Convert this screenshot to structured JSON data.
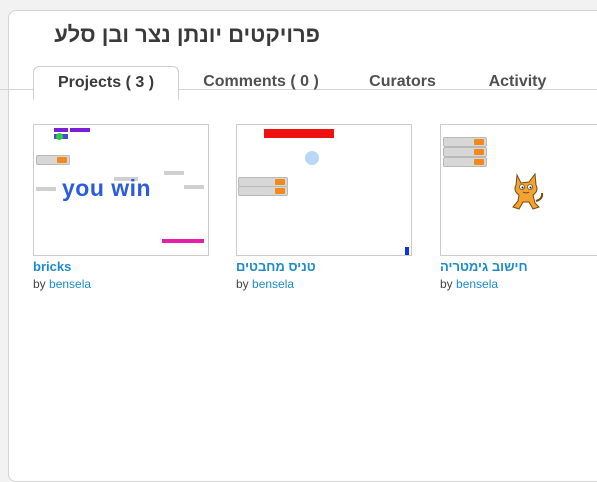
{
  "gallery": {
    "title": "פרויקטים יונתן נצר ובן סלע"
  },
  "tabs": [
    {
      "label": "Projects ( 3 )",
      "active": true
    },
    {
      "label": "Comments ( 0 )",
      "active": false
    },
    {
      "label": "Curators",
      "active": false
    },
    {
      "label": "Activity",
      "active": false
    }
  ],
  "projects": [
    {
      "title": "bricks",
      "by_prefix": "by",
      "author": "bensela",
      "thumb_text": "you win"
    },
    {
      "title": "טניס מחבטים",
      "by_prefix": "by",
      "author": "bensela"
    },
    {
      "title": "חישוב גימטריה",
      "by_prefix": "by",
      "author": "bensela"
    }
  ],
  "colors": {
    "link": "#1b8bc9",
    "monitor_value": "#f28a1b"
  }
}
